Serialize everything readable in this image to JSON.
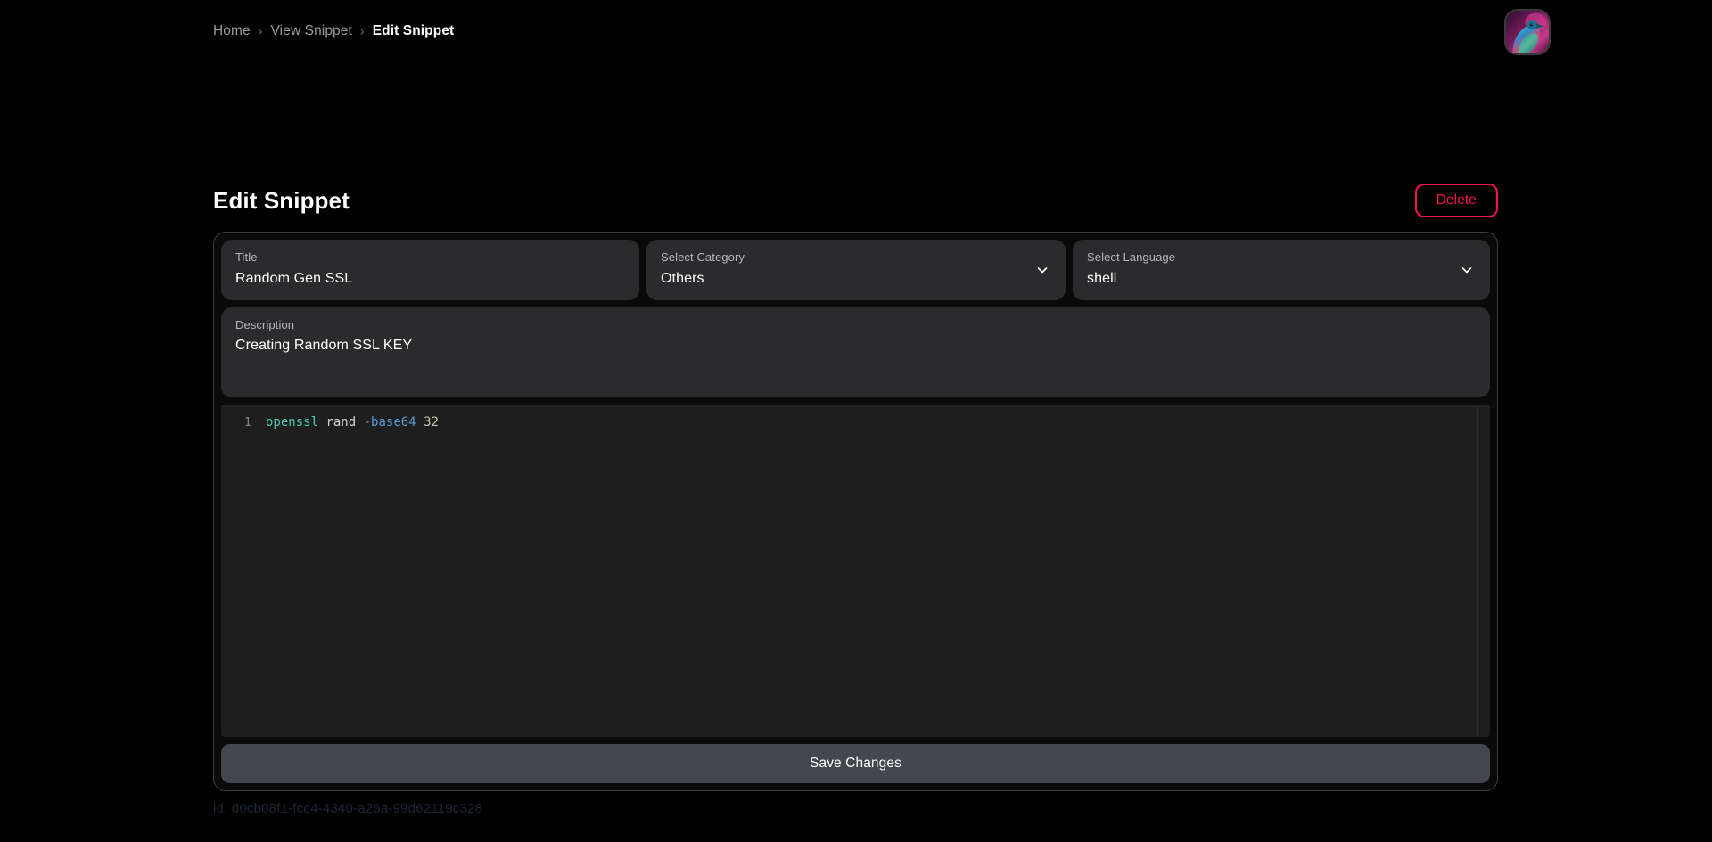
{
  "breadcrumb": {
    "items": [
      {
        "label": "Home",
        "current": false
      },
      {
        "label": "View Snippet",
        "current": false
      },
      {
        "label": "Edit Snippet",
        "current": true
      }
    ],
    "separator": "›"
  },
  "avatar": {
    "icon": "user-avatar-bird-image",
    "alt": "User avatar"
  },
  "header": {
    "title": "Edit Snippet",
    "delete_label": "Delete"
  },
  "form": {
    "title_field": {
      "label": "Title",
      "value": "Random Gen SSL",
      "placeholder": "Title"
    },
    "category_field": {
      "label": "Select Category",
      "value": "Others",
      "icon": "chevron-down-icon"
    },
    "language_field": {
      "label": "Select Language",
      "value": "shell",
      "icon": "chevron-down-icon"
    },
    "description_field": {
      "label": "Description",
      "value": "Creating Random SSL KEY",
      "placeholder": "Description"
    }
  },
  "editor": {
    "line_number": "1",
    "tokens": {
      "command": "openssl",
      "space1": " ",
      "subcommand": "rand",
      "space2": " ",
      "option": "-base64",
      "space3": " ",
      "number": "32"
    },
    "full_line": "openssl rand -base64 32",
    "colors": {
      "command": "#4ec9b0",
      "plain": "#d4d4d4",
      "option": "#569cd6",
      "number": "#b5cea8",
      "background": "#1e1e1e",
      "gutter": "#858585"
    }
  },
  "actions": {
    "save_label": "Save Changes"
  },
  "footer": {
    "id_text": "id: d0cb08f1-fcc4-4340-a26a-99d62119c328"
  },
  "colors": {
    "page_background": "#000000",
    "card_background": "#0a0a0b",
    "field_background": "#2b2b2d",
    "accent_danger": "#f3134f",
    "save_button": "#44474e"
  }
}
